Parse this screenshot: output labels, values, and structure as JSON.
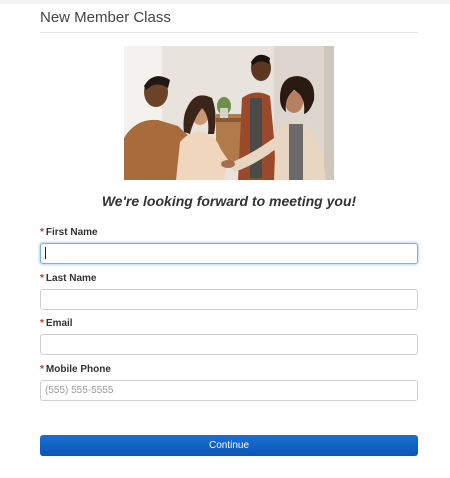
{
  "header": {
    "title": "New Member Class"
  },
  "hero": {
    "image": "group-handshake-photo"
  },
  "form": {
    "tagline": "We're looking forward to meeting you!",
    "required_marker": "*",
    "fields": [
      {
        "label": "First Name",
        "value": "",
        "placeholder": "",
        "focused": true
      },
      {
        "label": "Last Name",
        "value": "",
        "placeholder": ""
      },
      {
        "label": "Email",
        "value": "",
        "placeholder": ""
      },
      {
        "label": "Mobile Phone",
        "value": "",
        "placeholder": "(555) 555-5555"
      }
    ],
    "submit_label": "Continue"
  },
  "colors": {
    "button": "#0a5fc8",
    "required": "#c0392b",
    "focus_ring": "#7fb0e0"
  }
}
